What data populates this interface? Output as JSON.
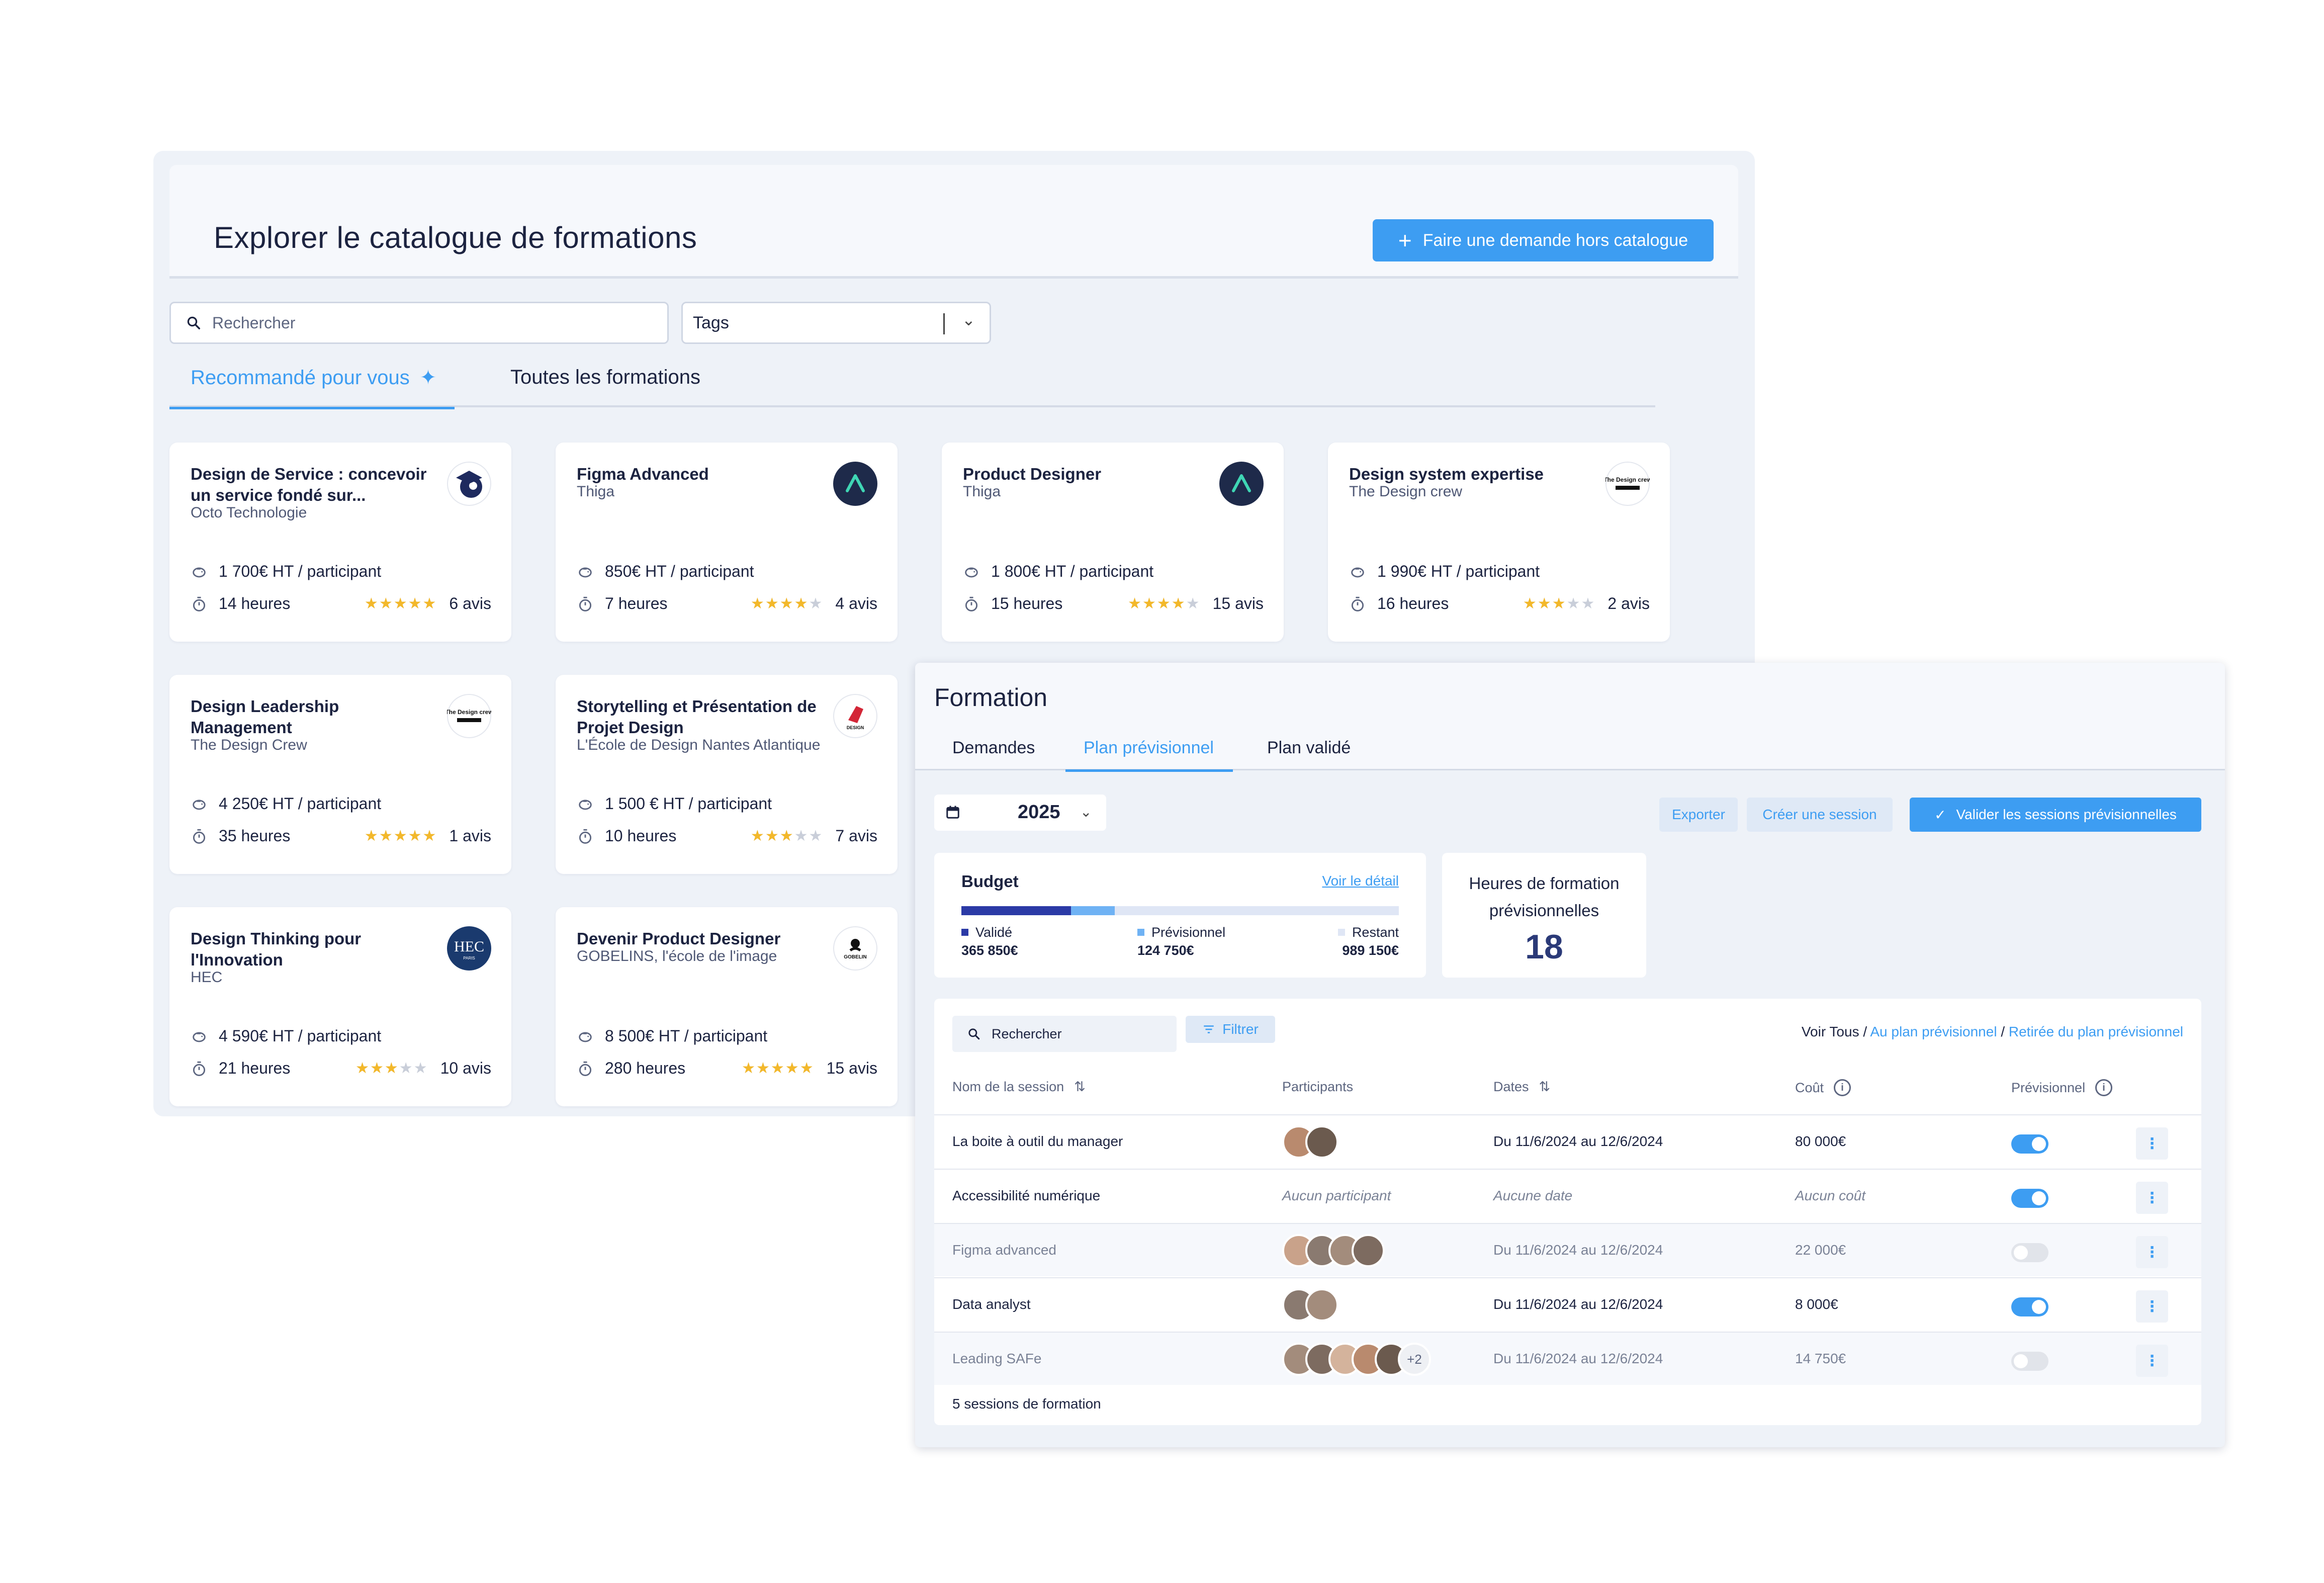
{
  "catalog": {
    "title": "Explorer le catalogue de formations",
    "request_button": "Faire une demande hors catalogue",
    "search_placeholder": "Rechercher",
    "tags_placeholder": "Tags",
    "tabs": [
      {
        "label": "Recommandé pour vous",
        "active": true
      },
      {
        "label": "Toutes les formations",
        "active": false
      }
    ],
    "cards": [
      {
        "title": "Design de Service : concevoir un service fondé sur...",
        "provider": "Octo Technologie",
        "price": "1 700€ HT / participant",
        "hours": "14 heures",
        "rating": 5,
        "reviews": "6 avis",
        "logo": "octo-logo"
      },
      {
        "title": "Figma Advanced",
        "provider": "Thiga",
        "price": "850€ HT / participant",
        "hours": "7 heures",
        "rating": 4,
        "reviews": "4 avis",
        "logo": "thiga-logo"
      },
      {
        "title": "Product Designer",
        "provider": "Thiga",
        "price": "1 800€ HT / participant",
        "hours": "15 heures",
        "rating": 4,
        "reviews": "15 avis",
        "logo": "thiga-logo"
      },
      {
        "title": "Design system expertise",
        "provider": "The Design crew",
        "price": "1 990€ HT / participant",
        "hours": "16 heures",
        "rating": 3,
        "reviews": "2 avis",
        "logo": "design-crew-logo"
      },
      {
        "title": "Design Leadership Management",
        "provider": "The Design Crew",
        "price": "4 250€ HT / participant",
        "hours": "35 heures",
        "rating": 5,
        "reviews": "1 avis",
        "logo": "design-crew-logo"
      },
      {
        "title": "Storytelling et Présentation de Projet Design",
        "provider": "L'École de Design Nantes Atlantique",
        "price": "1 500 € HT / participant",
        "hours": "10 heures",
        "rating": 3,
        "reviews": "7 avis",
        "logo": "ecole-design-logo"
      },
      {
        "title": "Design Thinking pour l'Innovation",
        "provider": "HEC",
        "price": "4 590€ HT / participant",
        "hours": "21 heures",
        "rating": 3,
        "reviews": "10 avis",
        "logo": "hec-logo"
      },
      {
        "title": "Devenir Product Designer",
        "provider": "GOBELINS, l'école de l'image",
        "price": "8 500€ HT / participant",
        "hours": "280 heures",
        "rating": 5,
        "reviews": "15 avis",
        "logo": "gobelins-logo"
      }
    ],
    "logo_text": {
      "design_crew": "The Design crew",
      "ecole": "DESIGN",
      "hec": "HEC",
      "hec_sub": "PARIS",
      "gobelins": "GOBELIN"
    }
  },
  "formation": {
    "title": "Formation",
    "tabs": [
      {
        "label": "Demandes",
        "active": false
      },
      {
        "label": "Plan prévisionnel",
        "active": true
      },
      {
        "label": "Plan validé",
        "active": false
      }
    ],
    "year": "2025",
    "buttons": {
      "export": "Exporter",
      "create": "Créer une session",
      "validate": "Valider les sessions prévisionnelles"
    },
    "budget": {
      "title": "Budget",
      "link": "Voir le détail",
      "validated_label": "Validé",
      "validated_amount": "365 850€",
      "validated_fraction": 0.25,
      "forecast_label": "Prévisionnel",
      "forecast_amount": "124 750€",
      "forecast_fraction": 0.1,
      "remaining_label": "Restant",
      "remaining_amount": "989 150€",
      "colors": {
        "validated": "#2b3aa6",
        "forecast": "#6fb2f4",
        "remaining": "#dfe6f5"
      }
    },
    "hours": {
      "label": "Heures de formation prévisionnelles",
      "value": "18"
    },
    "table": {
      "search_placeholder": "Rechercher",
      "filter_label": "Filtrer",
      "view_prefix": "Voir Tous",
      "sep": " / ",
      "view_plan": "Au plan prévisionnel",
      "view_removed": "Retirée du plan prévisionnel",
      "headers": {
        "name": "Nom de la session",
        "participants": "Participants",
        "dates": "Dates",
        "cost": "Coût",
        "forecast": "Prévisionnel"
      },
      "rows": [
        {
          "name": "La boite à outil du manager",
          "participants": 2,
          "extra": "",
          "dates": "Du 11/6/2024 au 12/6/2024",
          "cost": "80 000€",
          "forecast": true,
          "muted": false
        },
        {
          "name": "Accessibilité numérique",
          "participants": 0,
          "no_participant": "Aucun participant",
          "dates": "Aucune date",
          "cost": "Aucun coût",
          "forecast": true,
          "muted": false,
          "empty": true
        },
        {
          "name": "Figma advanced",
          "participants": 4,
          "extra": "",
          "dates": "Du 11/6/2024 au 12/6/2024",
          "cost": "22 000€",
          "forecast": false,
          "muted": true
        },
        {
          "name": "Data analyst",
          "participants": 2,
          "extra": "",
          "dates": "Du 11/6/2024 au 12/6/2024",
          "cost": "8 000€",
          "forecast": true,
          "muted": false
        },
        {
          "name": "Leading SAFe",
          "participants": 5,
          "extra": "+2",
          "dates": "Du 11/6/2024 au 12/6/2024",
          "cost": "14 750€",
          "forecast": false,
          "muted": true
        }
      ],
      "footer": "5 sessions de formation"
    }
  },
  "colors": {
    "accent": "#3d9df2",
    "star": "#f3b82a",
    "toggle_on": "#3d9df2",
    "toggle_off": "#e1e4ea"
  }
}
